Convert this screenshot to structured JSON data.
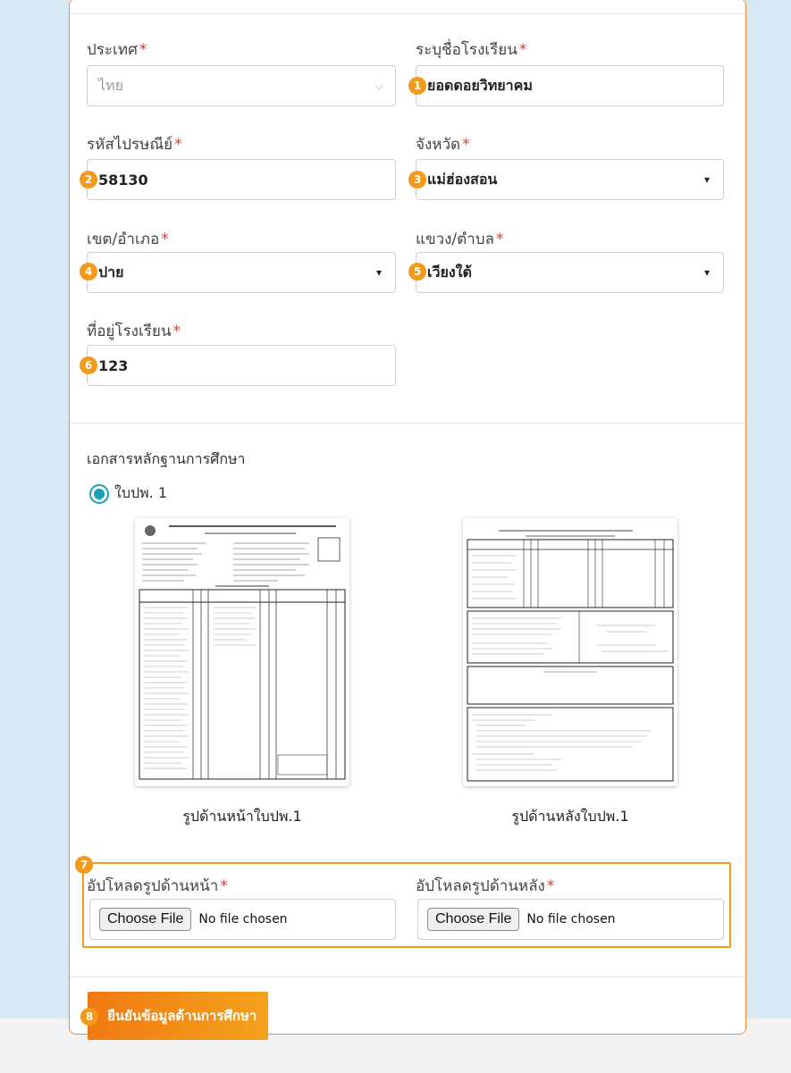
{
  "form": {
    "country": {
      "label": "ประเทศ",
      "required_mark": "*",
      "value": "ไทย"
    },
    "school_name": {
      "label": "ระบุชื่อโรงเรียน",
      "required_mark": "*",
      "value": "ยอดดอยวิทยาคม",
      "marker": "1"
    },
    "postal_code": {
      "label": "รหัสไปรษณีย์",
      "required_mark": "*",
      "value": "58130",
      "marker": "2"
    },
    "province": {
      "label": "จังหวัด",
      "required_mark": "*",
      "value": "แม่ฮ่องสอน",
      "marker": "3"
    },
    "district": {
      "label": "เขต/อำเภอ",
      "required_mark": "*",
      "value": "ปาย",
      "marker": "4"
    },
    "subdistrict": {
      "label": "แขวง/ตำบล",
      "required_mark": "*",
      "value": "เวียงใต้",
      "marker": "5"
    },
    "address": {
      "label": "ที่อยู่โรงเรียน",
      "required_mark": "*",
      "value": "123",
      "marker": "6"
    }
  },
  "education_docs": {
    "title": "เอกสารหลักฐานการศึกษา",
    "radio_option": "ใบปพ. 1",
    "front_caption": "รูปด้านหน้าใบปพ.1",
    "back_caption": "รูปด้านหลังใบปพ.1"
  },
  "upload": {
    "marker": "7",
    "front_label": "อัปโหลดรูปด้านหน้า",
    "back_label": "อัปโหลดรูปด้านหลัง",
    "required_mark": "*",
    "choose_label": "Choose File",
    "no_file_text": "No file chosen"
  },
  "submit": {
    "marker": "8",
    "label": "ยืนยันข้อมูลด้านการศึกษา"
  },
  "colors": {
    "accent": "#f39a1a",
    "required": "#e8352b",
    "radio": "#1aa0b8",
    "border": "#f08a3a"
  }
}
